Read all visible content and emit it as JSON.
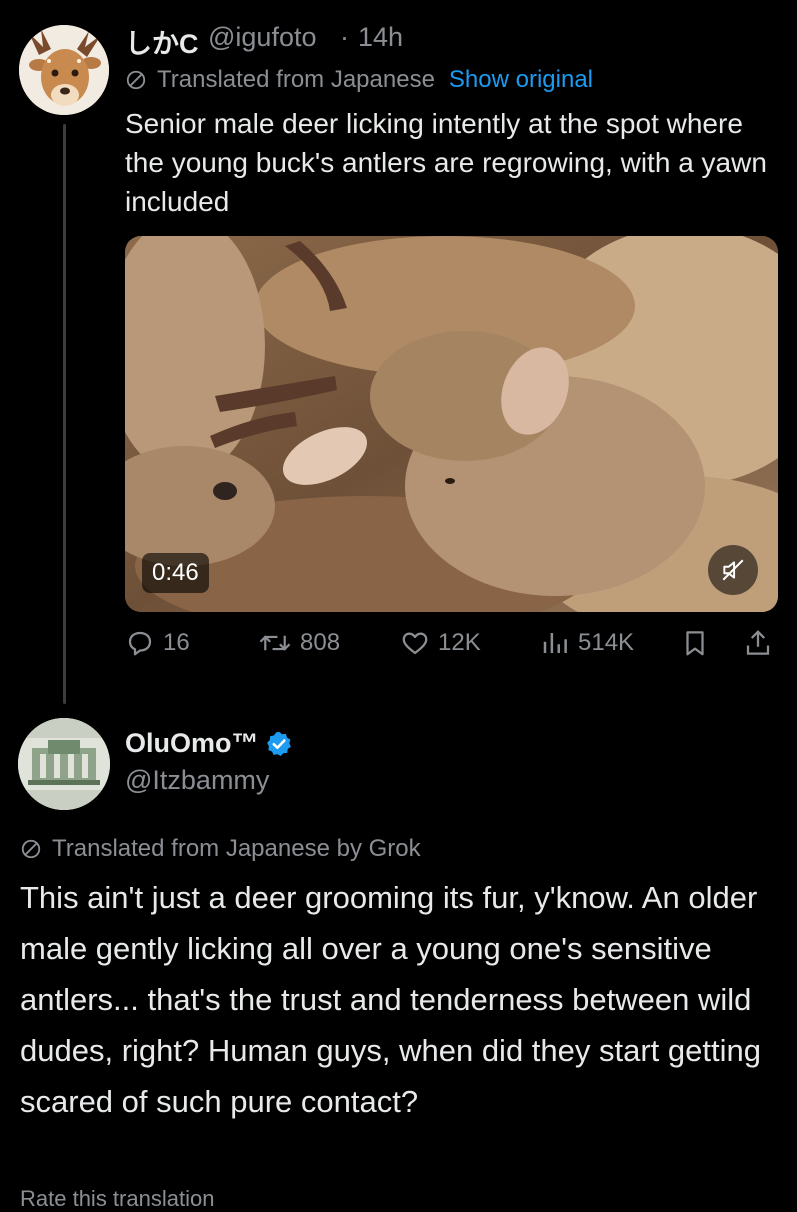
{
  "original_post": {
    "author_name": "しかC",
    "handle": "@igufoto",
    "separator": "·",
    "time": "14h",
    "translated_label": "Translated from Japanese",
    "show_original": "Show original",
    "text": "Senior male deer licking intently at the spot where the young buck's antlers are regrowing, with a yawn included",
    "video": {
      "duration": "0:46",
      "muted": true
    },
    "actions": {
      "replies": "16",
      "reposts": "808",
      "likes": "12K",
      "views": "514K"
    }
  },
  "reply": {
    "author_name": "OluOmo™",
    "verified": true,
    "handle": "@Itzbammy",
    "translated_label": "Translated from Japanese by Grok",
    "text": "This ain't just a deer grooming its fur, y'know. An older male gently licking all over a young one's sensitive antlers... that's the trust and tenderness between wild dudes, right?  Human guys, when did they start getting scared of such pure contact?",
    "cutoff_text": "Rate this translation"
  },
  "colors": {
    "background": "#000000",
    "text": "#e7e9ea",
    "secondary": "#8b8f94",
    "link": "#1d9bf0",
    "verified": "#1d9bf0"
  },
  "icons": [
    "translate-icon",
    "reply-icon",
    "repost-icon",
    "like-icon",
    "views-icon",
    "bookmark-icon",
    "share-icon",
    "mute-icon",
    "verified-badge-icon"
  ]
}
